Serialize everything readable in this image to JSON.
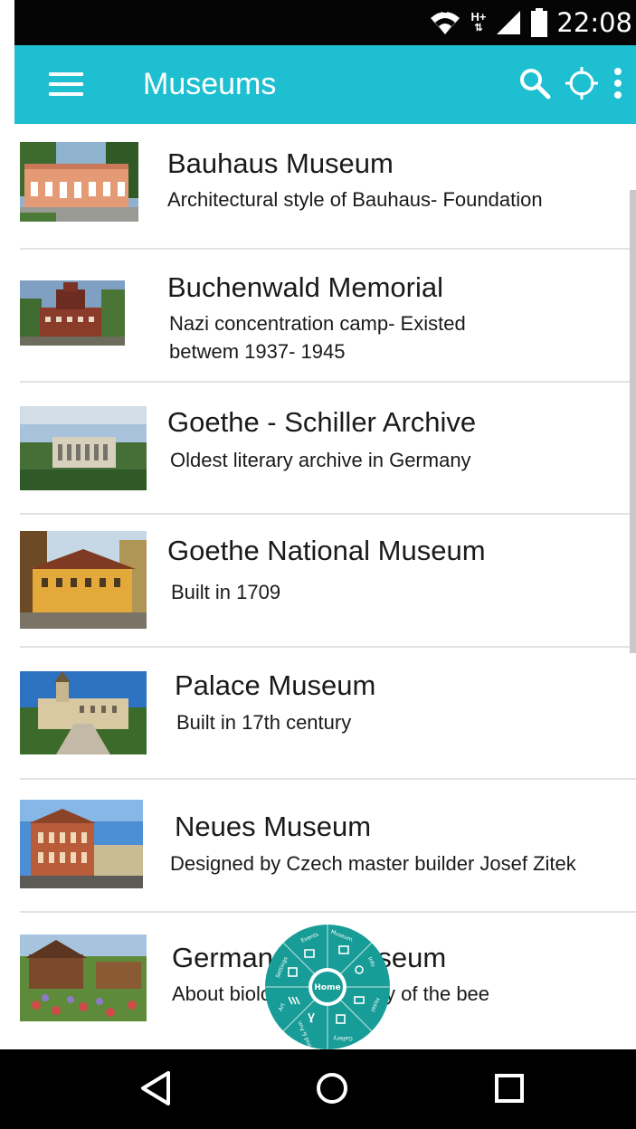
{
  "status_bar": {
    "time": "22:08",
    "network_label": "H+",
    "icons": [
      "wifi-icon",
      "network-type-icon",
      "signal-icon",
      "battery-icon"
    ]
  },
  "app_bar": {
    "title": "Museums",
    "icons": [
      "menu-icon",
      "search-icon",
      "location-icon",
      "more-options-icon"
    ],
    "background_color": "#1ebfd1"
  },
  "museums": [
    {
      "title": "Bauhaus Museum",
      "description": [
        "Architectural style of Bauhaus- Foundation"
      ]
    },
    {
      "title": "Buchenwald Memorial",
      "description": [
        "Nazi concentration camp- Existed",
        "betwem 1937- 1945"
      ]
    },
    {
      "title": "Goethe - Schiller Archive",
      "description": [
        "Oldest literary archive in Germany"
      ]
    },
    {
      "title": "Goethe National Museum",
      "description": [
        "Built in 1709"
      ]
    },
    {
      "title": "Palace Museum",
      "description": [
        "Built in 17th century"
      ]
    },
    {
      "title": "Neues Museum",
      "description": [
        "Designed by Czech master builder Josef Zitek"
      ]
    },
    {
      "title": "German Bee Museum",
      "description": [
        "About biology and history of the bee"
      ]
    }
  ],
  "radial_menu": {
    "center_label": "Home",
    "segments": [
      "Museum",
      "Info",
      "Hotel",
      "Gallery",
      "Food & Fun",
      "Art",
      "Settings",
      "Events"
    ],
    "color": "#179c97"
  },
  "nav_bar": {
    "icons": [
      "back-icon",
      "home-icon",
      "recents-icon"
    ]
  }
}
